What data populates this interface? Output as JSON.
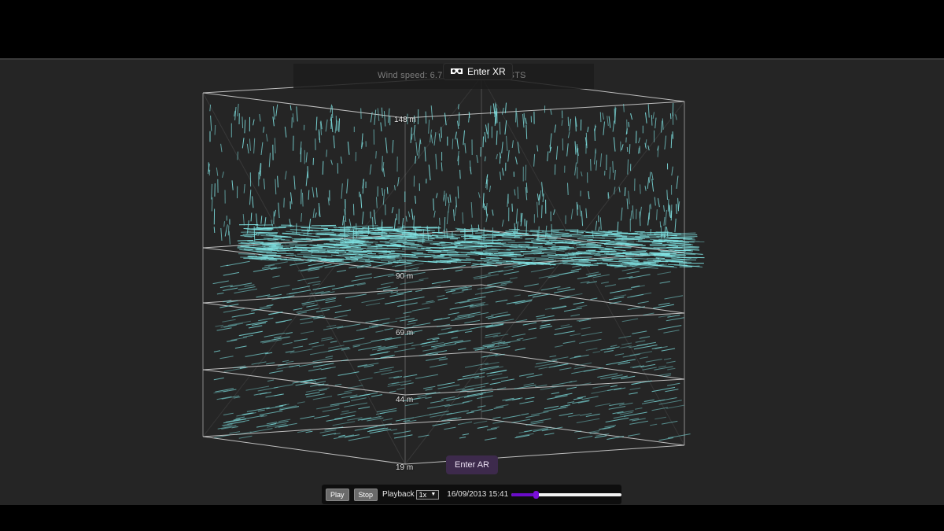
{
  "app": {
    "wind_speed_text": "Wind speed: 6.7 (m/s) — NO GUSTS",
    "enter_xr_label": "Enter XR",
    "enter_xr_icon": "vr-headset-icon",
    "enter_ar_label": "Enter AR"
  },
  "scene": {
    "height_labels": [
      "148 m",
      "90 m",
      "69 m",
      "44 m",
      "19 m"
    ],
    "arrow_color": "#7fe3e3",
    "frame_color": "#cfcfcf"
  },
  "controls": {
    "play_label": "Play",
    "stop_label": "Stop",
    "playback_label": "Playback",
    "speed_selected": "1x",
    "timestamp": "16/09/2013 15:41",
    "progress": 0.22,
    "accent_color": "#6a0cc9"
  }
}
